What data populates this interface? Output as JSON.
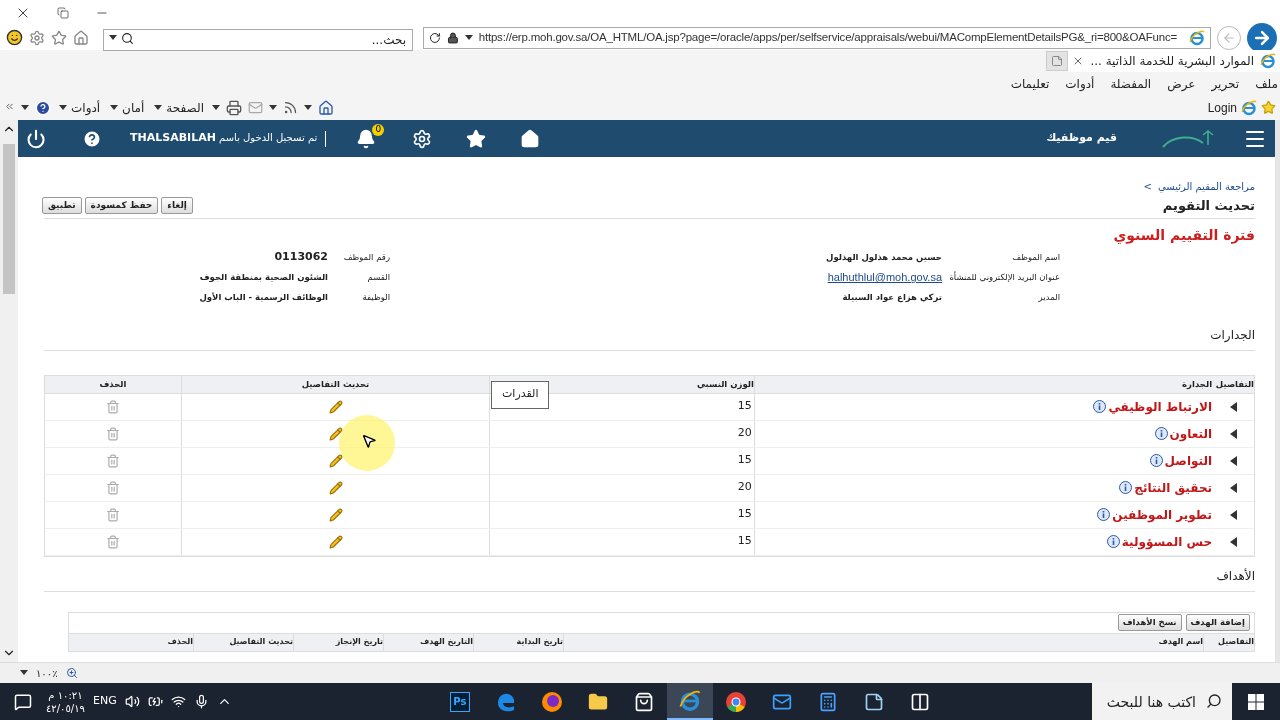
{
  "address_bar": {
    "search_placeholder": "بحث...",
    "url": "https://erp.moh.gov.sa/OA_HTML/OA.jsp?page=/oracle/apps/per/selfservice/appraisals/webui/MACompElementDetailsPG&_ri=800&OAFunc="
  },
  "tab": {
    "title": "الموارد البشرية للخدمة الذاتية ..."
  },
  "menu": [
    "ملف",
    "تحرير",
    "عرض",
    "المفضلة",
    "أدوات",
    "تعليمات"
  ],
  "command_bar": {
    "menus": [
      "الصفحة",
      "أمان",
      "أدوات"
    ],
    "login": "Login"
  },
  "header": {
    "app_title": "قيم موظفيك",
    "user_text": "تم تسجيل الدخول باسم",
    "user": "THALSABILAH",
    "notifications": "0"
  },
  "breadcrumb": {
    "label": "مراجعة المقيم الرئيسي",
    "separator": ">"
  },
  "title": "تحديث التقويم",
  "buttons": [
    "إلغاء",
    "حفظ كمسودة",
    "تطبيق"
  ],
  "period": "فترة التقييم السنوي",
  "info_right": [
    {
      "label": "اسم الموظف",
      "value": "حسين محمد هذلول الهذلول",
      "kind": "text"
    },
    {
      "label": "عنوان البريد الإلكتروني للمنشأة",
      "value": "halhuthlul@moh.gov.sa",
      "kind": "link"
    },
    {
      "label": "المدير",
      "value": "تركي هزاع عواد السبيلة",
      "kind": "text"
    }
  ],
  "info_left": [
    {
      "label": "رقم الموظف",
      "value": "0113062",
      "kind": "strong"
    },
    {
      "label": "القسم",
      "value": "الشئون الصحية بمنطقة الجوف",
      "kind": "text"
    },
    {
      "label": "الوظيفة",
      "value": "الوظائف الرسمية - الباب الأول",
      "kind": "text"
    }
  ],
  "competencies": {
    "title": "الجدارات",
    "columns": [
      "التفاصيل",
      "الجدارة",
      "الوزن النسبي",
      "تحديث التفاصيل",
      "الحذف"
    ],
    "tooltip": "القدرات",
    "rows": [
      {
        "name": "الارتباط الوظيفي",
        "weight": "15"
      },
      {
        "name": "التعاون",
        "weight": "20"
      },
      {
        "name": "التواصل",
        "weight": "15"
      },
      {
        "name": "تحقيق النتائج",
        "weight": "20"
      },
      {
        "name": "تطوير الموظفين",
        "weight": "15"
      },
      {
        "name": "حس المسؤولية",
        "weight": "15"
      }
    ]
  },
  "goals": {
    "title": "الأهداف",
    "buttons": [
      "إضافة الهدف",
      "نسخ الأهداف"
    ],
    "columns": [
      "التفاصيل",
      "اسم الهدف",
      "تاريخ البداية",
      "التاريخ الهدف",
      "تاريخ الإنجاز",
      "تحديث التفاصيل",
      "الحذف"
    ]
  },
  "status_bar": {
    "zoom": "١٠٠٪"
  },
  "taskbar": {
    "search_placeholder": "اكتب هنا للبحث",
    "language": "ENG",
    "time": "١٠:٢١ م",
    "date": "٤٢/٠٥/١٩",
    "apps": [
      {
        "kind": "taskview",
        "selected": false
      },
      {
        "kind": "notes",
        "selected": false
      },
      {
        "kind": "calculator",
        "selected": false
      },
      {
        "kind": "mail",
        "selected": false
      },
      {
        "kind": "chrome",
        "selected": false
      },
      {
        "kind": "ie",
        "selected": true
      },
      {
        "kind": "store",
        "selected": false
      },
      {
        "kind": "folder",
        "selected": false
      },
      {
        "kind": "firefox",
        "selected": false
      },
      {
        "kind": "edge",
        "selected": false
      },
      {
        "kind": "photoshop",
        "selected": false,
        "label": "Ps"
      }
    ]
  }
}
